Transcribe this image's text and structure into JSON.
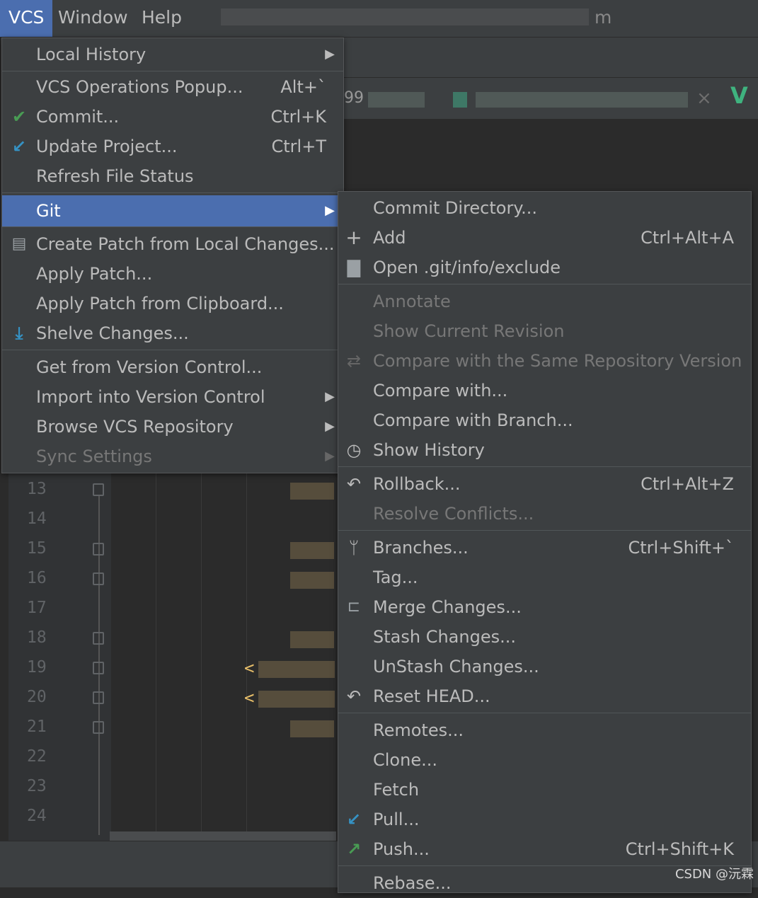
{
  "menubar": {
    "vcs": "VCS",
    "window": "Window",
    "help": "Help",
    "title_tail": "m"
  },
  "tab": {
    "fragment": "99",
    "close": "×",
    "check": "V"
  },
  "editor": {
    "lines": [
      "13",
      "14",
      "15",
      "16",
      "17",
      "18",
      "19",
      "20",
      "21",
      "22",
      "23",
      "24"
    ]
  },
  "vcs_menu": {
    "items": [
      {
        "label": "Local History",
        "submenu": true
      },
      {
        "label": "VCS Operations Popup...",
        "shortcut": "Alt+`"
      },
      {
        "label": "Commit...",
        "shortcut": "Ctrl+K",
        "icon": "check-icon"
      },
      {
        "label": "Update Project...",
        "shortcut": "Ctrl+T",
        "icon": "update-icon"
      },
      {
        "label": "Refresh File Status"
      },
      {
        "label": "Git",
        "submenu": true,
        "selected": true
      },
      {
        "label": "Create Patch from Local Changes...",
        "icon": "patch-icon"
      },
      {
        "label": "Apply Patch..."
      },
      {
        "label": "Apply Patch from Clipboard..."
      },
      {
        "label": "Shelve Changes...",
        "icon": "shelve-icon"
      },
      {
        "label": "Get from Version Control..."
      },
      {
        "label": "Import into Version Control",
        "submenu": true
      },
      {
        "label": "Browse VCS Repository",
        "submenu": true
      },
      {
        "label": "Sync Settings",
        "submenu": true,
        "disabled": true
      }
    ]
  },
  "git_menu": {
    "items": [
      {
        "label": "Commit Directory..."
      },
      {
        "label": "Add",
        "shortcut": "Ctrl+Alt+A",
        "icon": "plus-icon"
      },
      {
        "label": "Open .git/info/exclude",
        "icon": "file-icon"
      },
      {
        "label": "Annotate",
        "disabled": true
      },
      {
        "label": "Show Current Revision",
        "disabled": true
      },
      {
        "label": "Compare with the Same Repository Version",
        "disabled": true,
        "icon": "compare-icon"
      },
      {
        "label": "Compare with..."
      },
      {
        "label": "Compare with Branch..."
      },
      {
        "label": "Show History",
        "icon": "clock-icon"
      },
      {
        "label": "Rollback...",
        "shortcut": "Ctrl+Alt+Z",
        "icon": "undo-icon"
      },
      {
        "label": "Resolve Conflicts...",
        "disabled": true
      },
      {
        "label": "Branches...",
        "shortcut": "Ctrl+Shift+`",
        "icon": "branch-icon"
      },
      {
        "label": "Tag..."
      },
      {
        "label": "Merge Changes...",
        "icon": "merge-icon"
      },
      {
        "label": "Stash Changes..."
      },
      {
        "label": "UnStash Changes..."
      },
      {
        "label": "Reset HEAD...",
        "icon": "reset-icon"
      },
      {
        "label": "Remotes..."
      },
      {
        "label": "Clone..."
      },
      {
        "label": "Fetch"
      },
      {
        "label": "Pull...",
        "icon": "pull-icon"
      },
      {
        "label": "Push...",
        "shortcut": "Ctrl+Shift+K",
        "icon": "push-icon"
      },
      {
        "label": "Rebase..."
      }
    ]
  },
  "watermark": "CSDN @沅霖",
  "colors": {
    "accent": "#4b6eaf",
    "menu_bg": "#3c3f41",
    "editor_bg": "#2b2b2b",
    "green": "#499c54",
    "blue": "#3592c4"
  }
}
